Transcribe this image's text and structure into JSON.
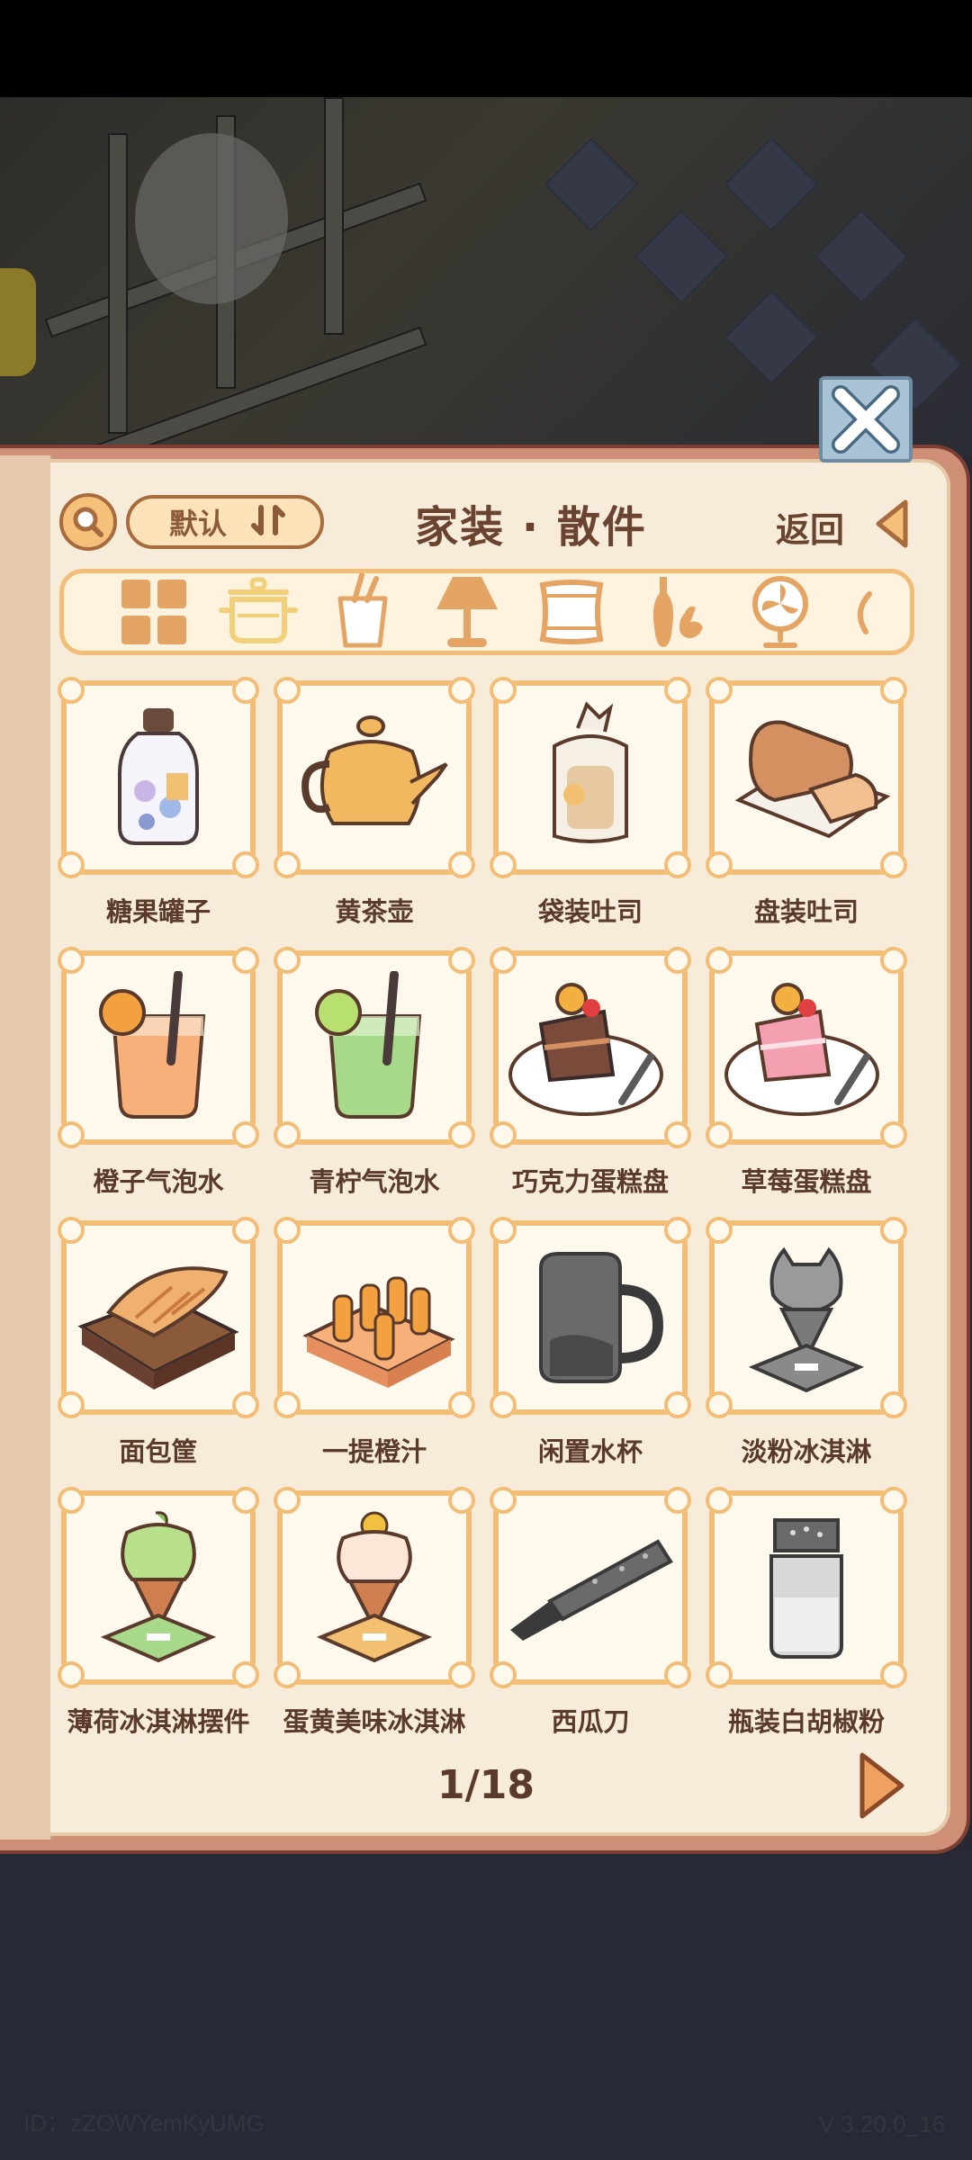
{
  "header": {
    "sort_label": "默认",
    "title": "家装 · 散件",
    "back_label": "返回"
  },
  "category_tabs": [
    {
      "icon": "grid-icon",
      "selected": false
    },
    {
      "icon": "pot-icon",
      "selected": true
    },
    {
      "icon": "cup-icon",
      "selected": false
    },
    {
      "icon": "lamp-icon",
      "selected": false
    },
    {
      "icon": "pillow-icon",
      "selected": false
    },
    {
      "icon": "vase-icon",
      "selected": false
    },
    {
      "icon": "fan-icon",
      "selected": false
    },
    {
      "icon": "more-icon",
      "selected": false
    }
  ],
  "items": [
    {
      "name": "糖果罐子",
      "icon": "candy-jar-icon"
    },
    {
      "name": "黄茶壶",
      "icon": "teapot-icon"
    },
    {
      "name": "袋装吐司",
      "icon": "bagged-toast-icon"
    },
    {
      "name": "盘装吐司",
      "icon": "plate-toast-icon"
    },
    {
      "name": "橙子气泡水",
      "icon": "orange-soda-icon"
    },
    {
      "name": "青柠气泡水",
      "icon": "lime-soda-icon"
    },
    {
      "name": "巧克力蛋糕盘",
      "icon": "chocolate-cake-icon"
    },
    {
      "name": "草莓蛋糕盘",
      "icon": "strawberry-cake-icon"
    },
    {
      "name": "面包筐",
      "icon": "bread-basket-icon"
    },
    {
      "name": "一提橙汁",
      "icon": "orange-juice-crate-icon"
    },
    {
      "name": "闲置水杯",
      "icon": "mug-icon"
    },
    {
      "name": "淡粉冰淇淋",
      "icon": "gray-ice-cream-icon"
    },
    {
      "name": "薄荷冰淇淋摆件",
      "icon": "mint-ice-cream-icon"
    },
    {
      "name": "蛋黄美味冰淇淋",
      "icon": "yolk-ice-cream-icon"
    },
    {
      "name": "西瓜刀",
      "icon": "knife-icon"
    },
    {
      "name": "瓶装白胡椒粉",
      "icon": "pepper-shaker-icon"
    }
  ],
  "pager": {
    "text": "1/18"
  },
  "footer": {
    "id_text": "ID：zZOWYemKyUMG",
    "version_text": "V 3.20.0_16"
  },
  "colors": {
    "frame": "#f2be77",
    "panel": "#f7ecd9",
    "text": "#5a3a2a",
    "accent_orange": "#f0a060"
  }
}
